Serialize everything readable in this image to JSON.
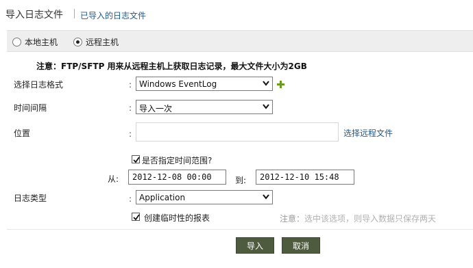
{
  "header": {
    "title": "导入日志文件",
    "imported_link": "已导入的日志文件"
  },
  "source_options": [
    {
      "label": "本地主机",
      "selected": false
    },
    {
      "label": "远程主机",
      "selected": true
    }
  ],
  "note": "注意：FTP/SFTP 用来从远程主机上获取日志记录，最大文件大小为2GB",
  "form": {
    "colon": ":",
    "log_format": {
      "label": "选择日志格式",
      "value": "Windows EventLog"
    },
    "interval": {
      "label": "时间间隔",
      "value": "导入一次"
    },
    "location": {
      "label": "位置",
      "value": "",
      "link": "选择远程文件"
    },
    "time_range": {
      "label": "是否指定时间范围?",
      "checked": true
    },
    "from": {
      "label": "从:",
      "value": "2012-12-08 00:00"
    },
    "to": {
      "label": "到:",
      "value": "2012-12-10 15:48"
    },
    "log_type": {
      "label": "日志类型",
      "value": "Application"
    },
    "temp_report": {
      "label": "创建临时性的报表",
      "checked": true
    },
    "hint": {
      "prefix": "注意：",
      "text": "选中该选项，则导入数据只保存两天"
    }
  },
  "buttons": {
    "import": "导入",
    "cancel": "取消"
  },
  "colors": {
    "link": "#1e5a8c",
    "button_bg": "#4f5b3f",
    "plus_icon": "#6a9a22",
    "radio_bar_bg": "#eeeeee"
  },
  "icons": [
    "plus-icon",
    "chevron-down-icon",
    "checkmark-icon",
    "radio-icon"
  ]
}
